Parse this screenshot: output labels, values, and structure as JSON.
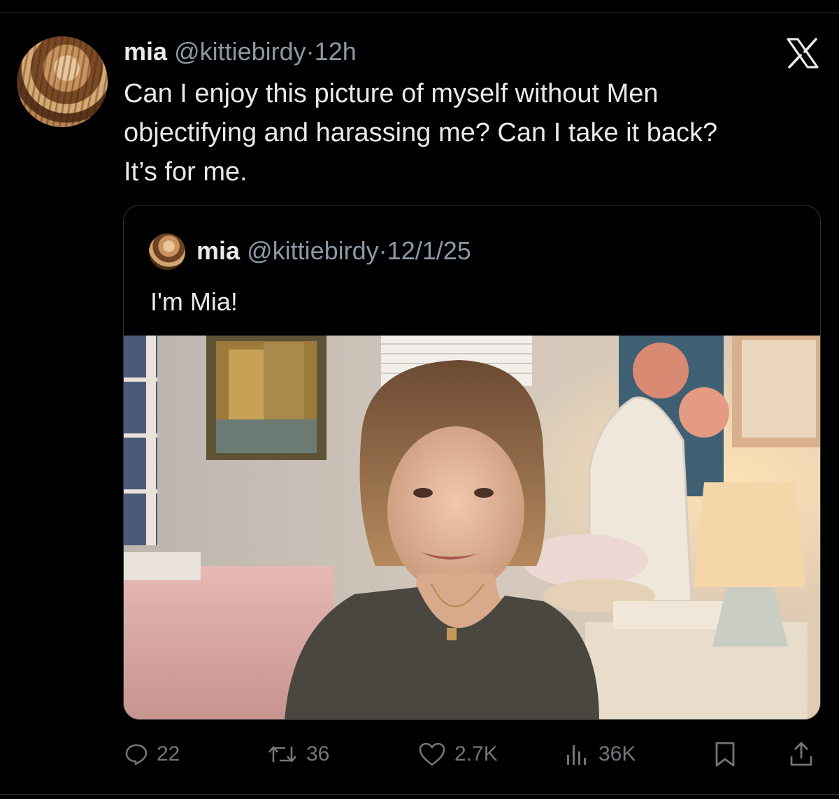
{
  "tweet": {
    "name": "mia",
    "handle": "@kittiebirdy",
    "separator": "·",
    "time": "12h",
    "text": "Can I enjoy this picture of myself without Men\nobjectifying and harassing me? Can I take it back?\nIt’s for me.",
    "logo_icon": "x-logo-icon"
  },
  "quoted": {
    "name": "mia",
    "handle": "@kittiebirdy",
    "separator": "·",
    "date": "12/1/25",
    "text": "I'm Mia!",
    "media": "photo"
  },
  "actions": {
    "replies": "22",
    "reposts": "36",
    "likes": "2.7K",
    "views": "36K"
  },
  "colors": {
    "background": "#000000",
    "text": "#e7e9ea",
    "secondary": "#8b98a5",
    "border": "#2f3336"
  }
}
